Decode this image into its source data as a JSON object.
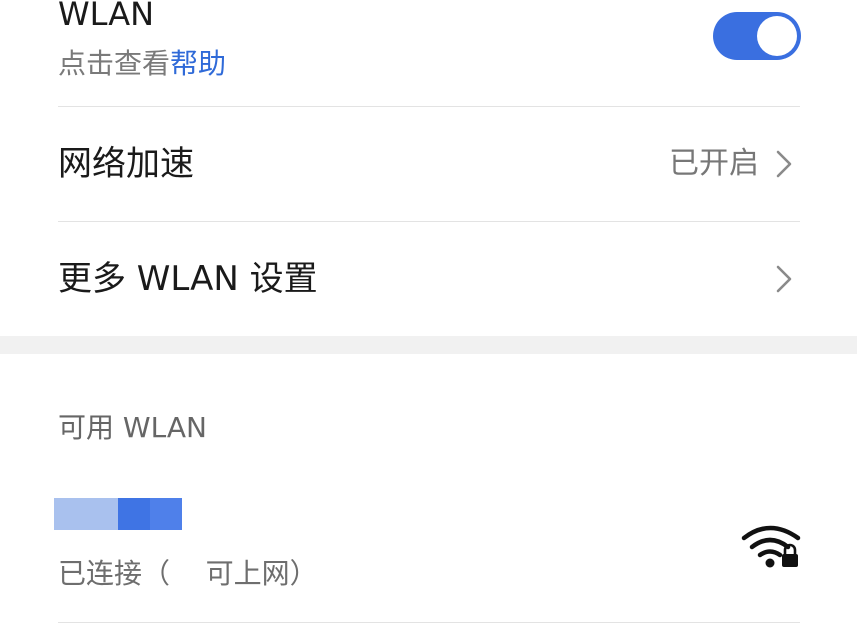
{
  "wlan": {
    "title": "WLAN",
    "help_prefix": "点击查看",
    "help_link": "帮助",
    "enabled": true
  },
  "network_acceleration": {
    "label": "网络加速",
    "value": "已开启"
  },
  "more_settings": {
    "label": "更多 WLAN 设置"
  },
  "available": {
    "section_title": "可用 WLAN",
    "networks": [
      {
        "ssid_blurred": true,
        "status": "已连接（    可上网）",
        "icon": "wifi-lock-icon",
        "locked": true
      }
    ]
  },
  "colors": {
    "accent": "#3a6fe0",
    "link": "#2f6ad8",
    "ssid_blur": [
      "#a9c1ee",
      "#3f74e4",
      "#4f80ea",
      "#2f66de"
    ]
  }
}
